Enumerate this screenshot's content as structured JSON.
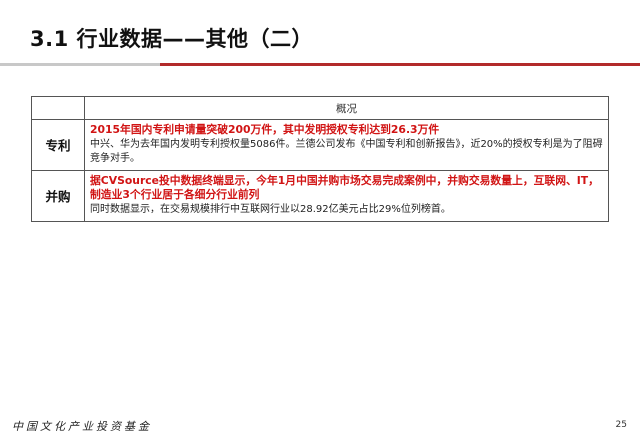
{
  "slide": {
    "title": "3.1 行业数据——其他（二）"
  },
  "table": {
    "header": "概况",
    "rows": [
      {
        "label": "专利",
        "highlight": "2015年国内专利申请量突破200万件，其中发明授权专利达到26.3万件",
        "body": "中兴、华为去年国内发明专利授权量5086件。兰德公司发布《中国专利和创新报告》，近20%的授权专利是为了阻碍竞争对手。"
      },
      {
        "label": "并购",
        "highlight": "据CVSource投中数据终端显示，今年1月中国并购市场交易完成案例中，并购交易数量上，互联网、IT，制造业3个行业居于各细分行业前列",
        "body": "同时数据显示，在交易规模排行中互联网行业以28.92亿美元占比29%位列榜首。"
      }
    ]
  },
  "footer": {
    "logo_text": "中国文化产业投资基金",
    "page_number": "25"
  },
  "colors": {
    "accent_red": "#b22a2a",
    "highlight_red": "#d11414",
    "rule_gray": "#c8c8c8"
  }
}
